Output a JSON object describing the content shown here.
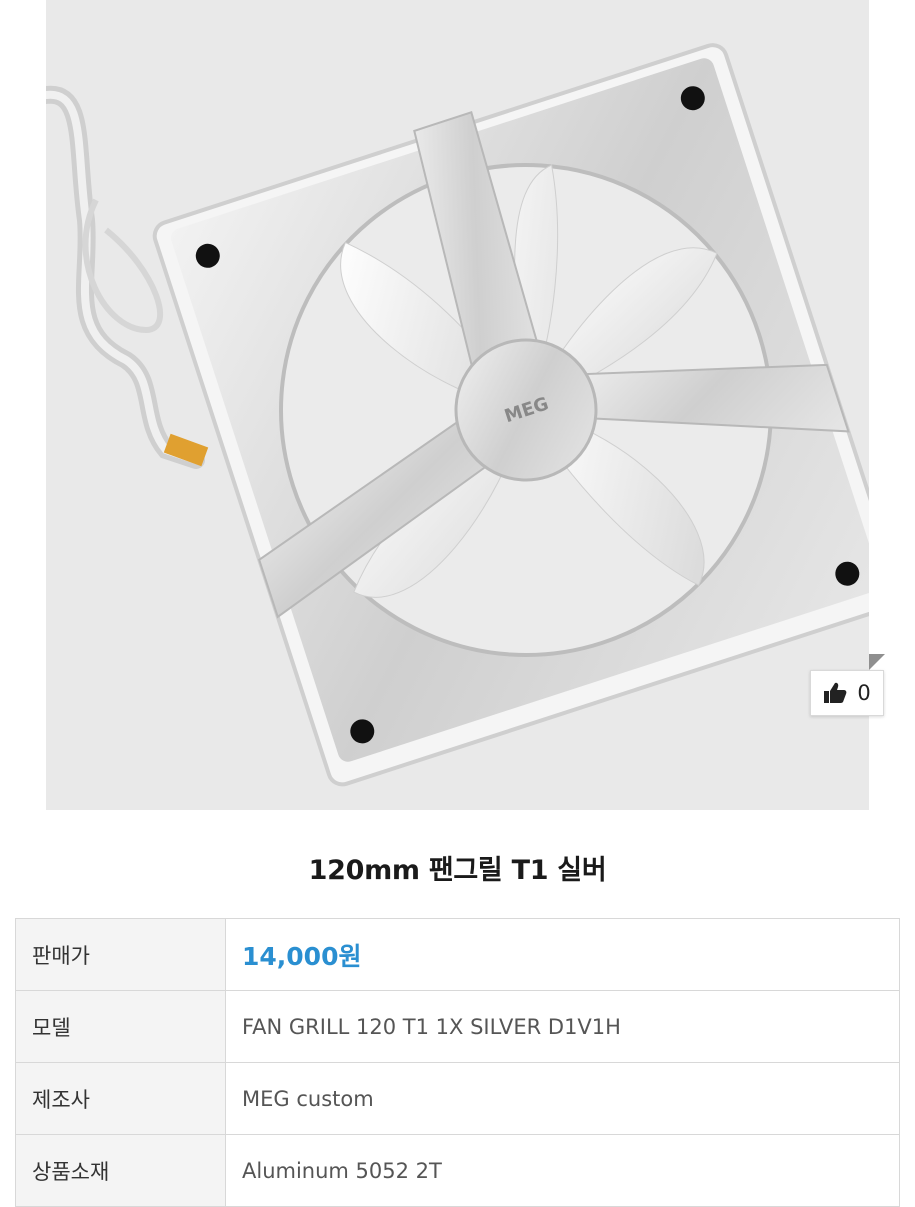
{
  "product": {
    "title": "120mm 팬그릴 T1 실버",
    "image_alt": "120mm fan grill T1 silver product photo",
    "grill_logo_text": "MEG"
  },
  "like": {
    "icon": "thumbs-up-icon",
    "count": "0"
  },
  "specs": [
    {
      "label": "판매가",
      "value": "14,000원",
      "highlight": true
    },
    {
      "label": "모델",
      "value": "FAN GRILL 120 T1 1X SILVER D1V1H"
    },
    {
      "label": "제조사",
      "value": "MEG custom"
    },
    {
      "label": "상품소재",
      "value": "Aluminum 5052 2T"
    }
  ],
  "colors": {
    "price": "#2a8fd1",
    "label_bg": "#f4f4f4",
    "border": "#d8d8d8"
  }
}
